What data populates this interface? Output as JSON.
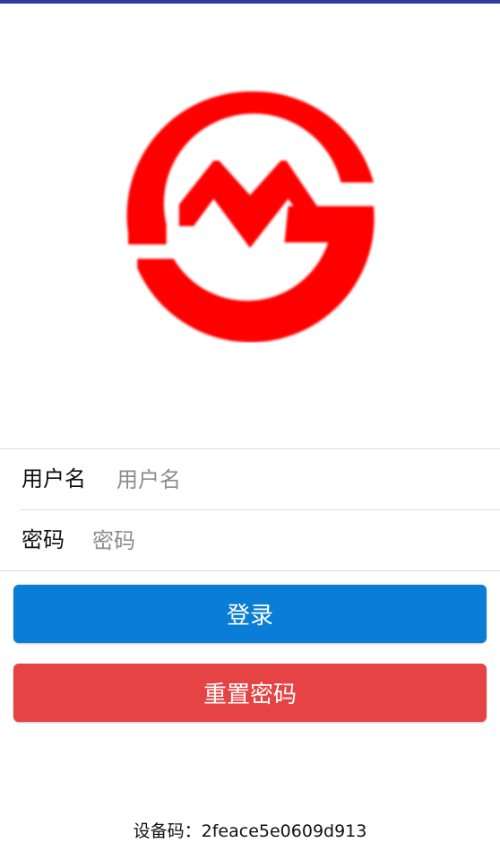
{
  "theme": {
    "top_bar_color": "#2c3e9a",
    "logo_color": "#ff0000",
    "login_button_color": "#0a7dd6",
    "reset_button_color": "#e64444"
  },
  "logo": {
    "icon": "shanghai-metro-logo-icon"
  },
  "form": {
    "username": {
      "label": "用户名",
      "placeholder": "用户名",
      "value": ""
    },
    "password": {
      "label": "密码",
      "placeholder": "密码",
      "value": ""
    }
  },
  "buttons": {
    "login_label": "登录",
    "reset_label": "重置密码"
  },
  "device": {
    "label": "设备码：",
    "code": "2feace5e0609d913"
  }
}
